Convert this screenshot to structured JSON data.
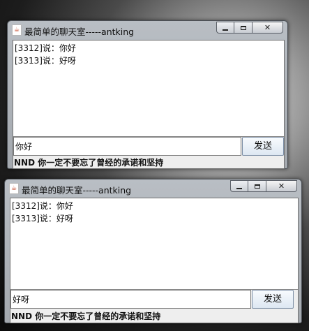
{
  "windows": [
    {
      "title": "最简单的聊天室-----antking",
      "icon": "java-icon",
      "controls": {
        "minimize": "minimize-icon",
        "maximize": "maximize-icon",
        "close": "✕"
      },
      "messages": [
        "[3312]说：你好",
        "[3313]说：好呀"
      ],
      "input_value": "你好",
      "send_label": "发送",
      "status": "NND 你一定不要忘了曾经的承诺和坚持"
    },
    {
      "title": "最简单的聊天室-----antking",
      "icon": "java-icon",
      "controls": {
        "minimize": "minimize-icon",
        "maximize": "maximize-icon",
        "close": "✕"
      },
      "messages": [
        "[3312]说：你好",
        "[3313]说：好呀"
      ],
      "input_value": "好呀",
      "send_label": "发送",
      "status": "NND 你一定不要忘了曾经的承诺和坚持"
    }
  ]
}
